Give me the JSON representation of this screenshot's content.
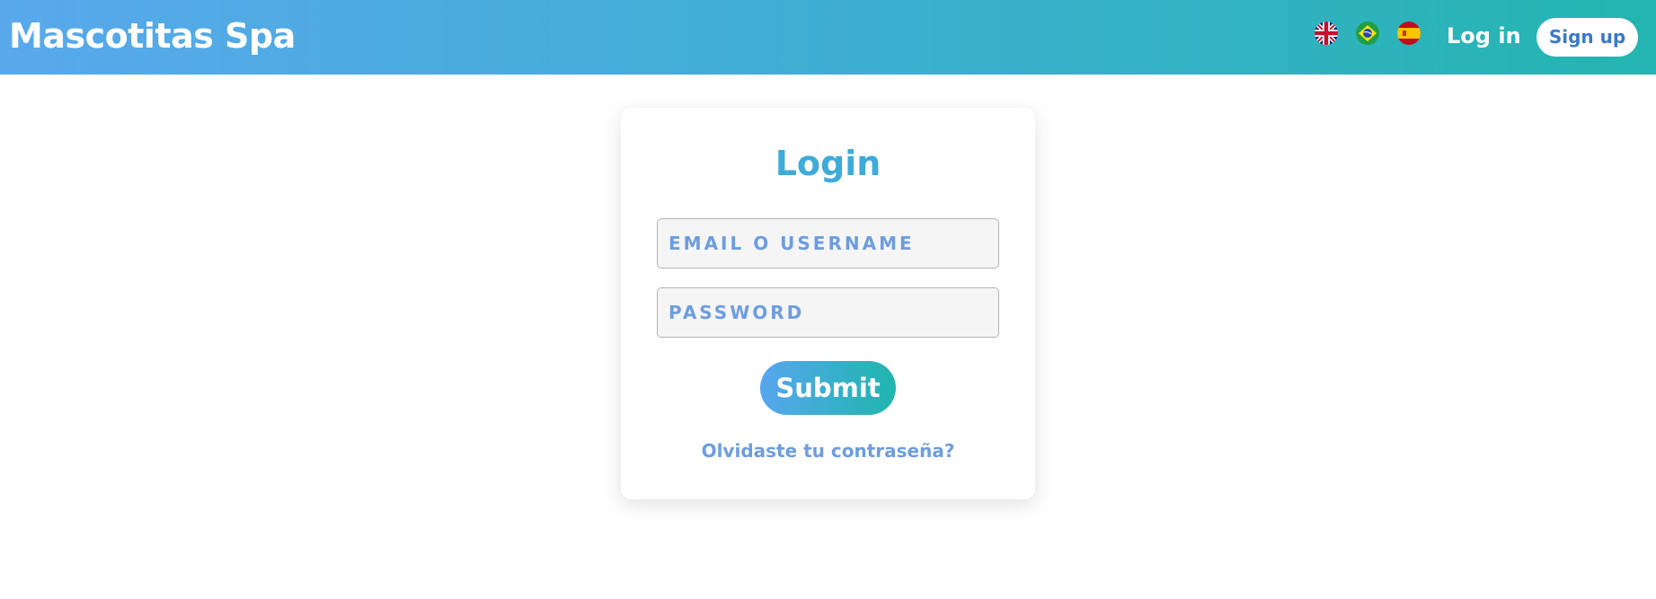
{
  "navbar": {
    "brand": "Mascotitas Spa",
    "flags": [
      {
        "icon": "flag-uk-icon",
        "language": "English"
      },
      {
        "icon": "flag-brazil-icon",
        "language": "Portuguese"
      },
      {
        "icon": "flag-spain-icon",
        "language": "Spanish"
      }
    ],
    "login_label": "Log in",
    "signup_label": "Sign up"
  },
  "login_form": {
    "title": "Login",
    "email": {
      "value": "",
      "placeholder": "EMAIL O USERNAME"
    },
    "password": {
      "value": "",
      "placeholder": "PASSWORD"
    },
    "submit_label": "Submit",
    "forgot_label": "Olvidaste tu contraseña?"
  },
  "colors": {
    "navbar_gradient_start": "#59a8ec",
    "navbar_gradient_end": "#24b5b0",
    "title": "#3eabd8",
    "placeholder": "#6d9de0",
    "signup_text": "#3b78c7"
  }
}
